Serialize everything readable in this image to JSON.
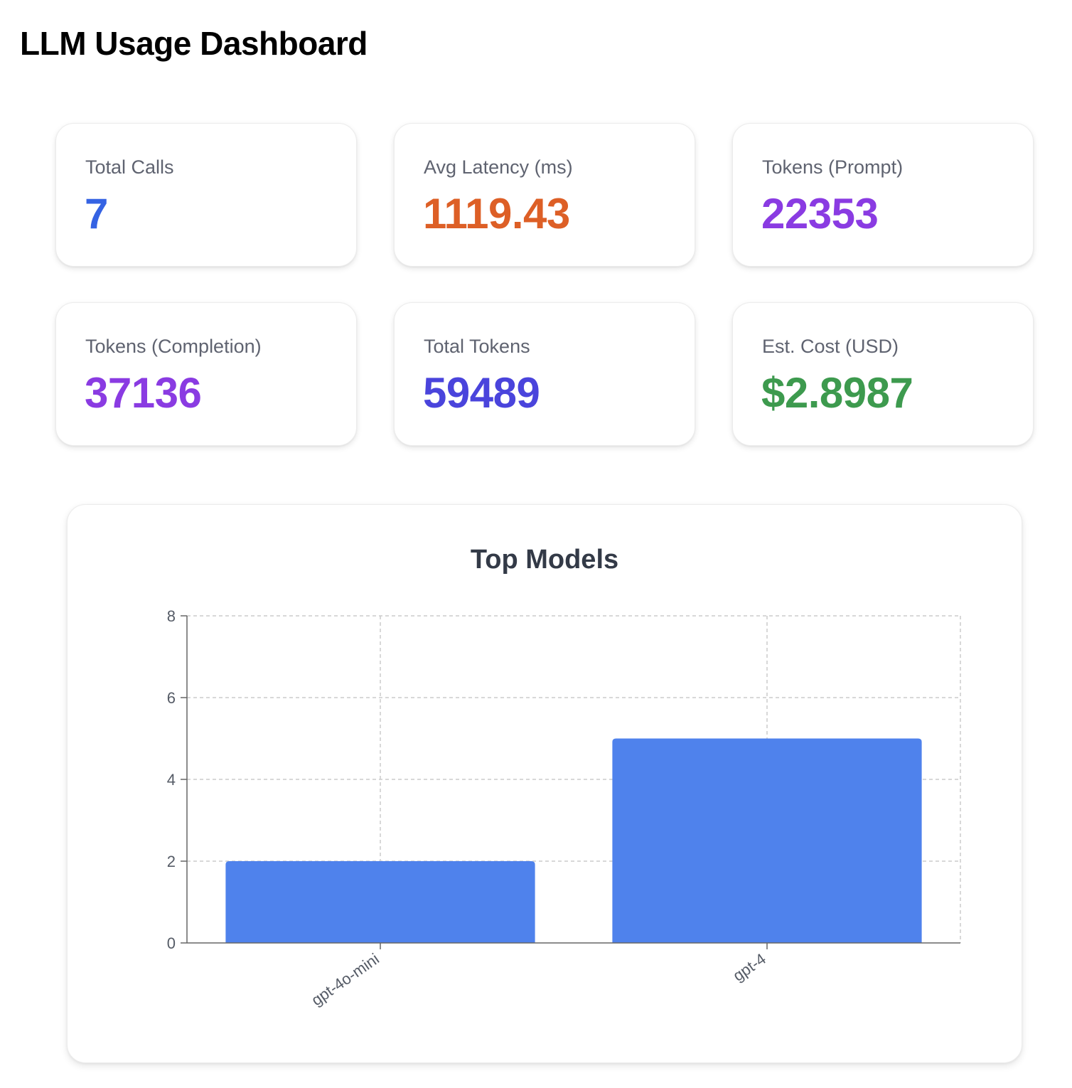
{
  "page": {
    "title": "LLM Usage Dashboard"
  },
  "stats": [
    {
      "label": "Total Calls",
      "value": "7",
      "color": "#3563e3"
    },
    {
      "label": "Avg Latency (ms)",
      "value": "1119.43",
      "color": "#dd5f26"
    },
    {
      "label": "Tokens (Prompt)",
      "value": "22353",
      "color": "#8a3be2"
    },
    {
      "label": "Tokens (Completion)",
      "value": "37136",
      "color": "#8a3be2"
    },
    {
      "label": "Total Tokens",
      "value": "59489",
      "color": "#4a44dc"
    },
    {
      "label": "Est. Cost (USD)",
      "value": "$2.8987",
      "color": "#3d9a4e"
    }
  ],
  "chart_data": {
    "type": "bar",
    "title": "Top Models",
    "categories": [
      "gpt-4o-mini",
      "gpt-4"
    ],
    "values": [
      2,
      5
    ],
    "ylim": [
      0,
      8
    ],
    "yticks": [
      "0",
      "2",
      "4",
      "6",
      "8"
    ],
    "xlabel": "",
    "ylabel": "",
    "grid": true,
    "bar_color": "#4f82ec"
  }
}
